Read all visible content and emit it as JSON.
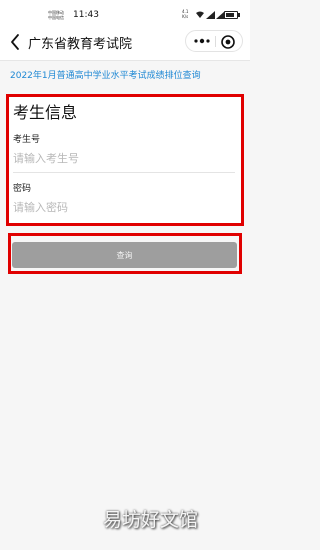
{
  "status_bar": {
    "carrier_1": "中国移动",
    "carrier_2": "中国电信",
    "time": "11:43",
    "net_speed_value": "4.1",
    "net_speed_unit": "K/s",
    "icons": [
      "wifi-icon",
      "signal-icon",
      "signal-icon",
      "battery-icon"
    ]
  },
  "nav": {
    "title": "广东省教育考试院",
    "back_icon": "chevron-left-icon",
    "more_icon": "more-dots-icon",
    "close_icon": "target-close-icon"
  },
  "page": {
    "heading": "2022年1月普通高中学业水平考试成绩排位查询"
  },
  "form": {
    "section_title": "考生信息",
    "exam_number_label": "考生号",
    "exam_number_placeholder": "请输入考生号",
    "exam_number_value": "",
    "password_label": "密码",
    "password_placeholder": "请输入密码",
    "password_value": ""
  },
  "buttons": {
    "query_label": "查询"
  },
  "watermark": {
    "text": "易坊好文馆"
  },
  "colors": {
    "heading_blue": "#1e88d4",
    "highlight_red": "#e00000",
    "button_gray": "#9e9e9e",
    "page_background": "#f6f6f6"
  }
}
